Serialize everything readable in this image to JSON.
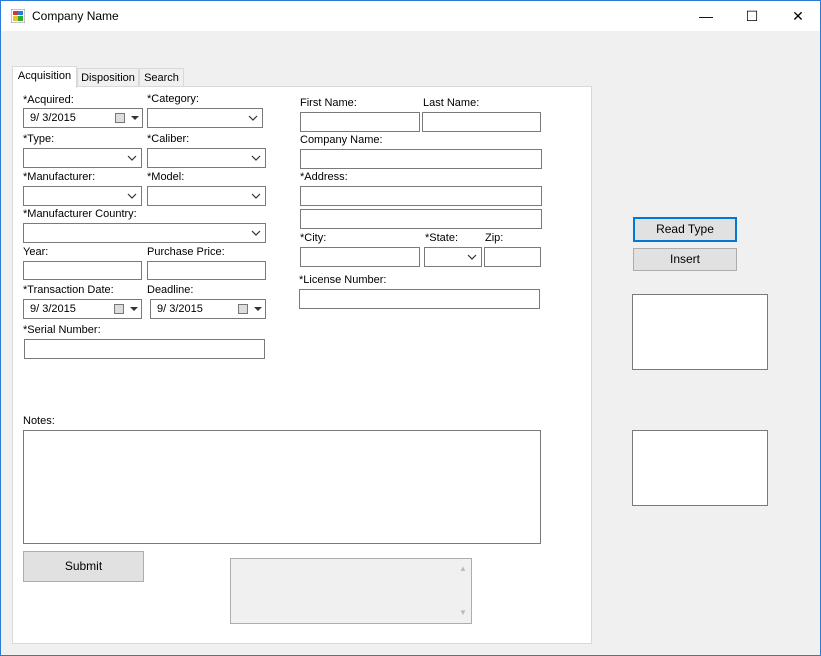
{
  "window": {
    "title": "Company Name",
    "minimize": "—",
    "maximize": "☐",
    "close": "✕"
  },
  "tabs": [
    "Acquisition",
    "Disposition",
    "Search"
  ],
  "form": {
    "acquired": {
      "label": "*Acquired:",
      "value": "9/  3/2015"
    },
    "category": {
      "label": "*Category:",
      "value": ""
    },
    "type": {
      "label": "*Type:",
      "value": ""
    },
    "caliber": {
      "label": "*Caliber:",
      "value": ""
    },
    "manufacturer": {
      "label": "*Manufacturer:",
      "value": ""
    },
    "model": {
      "label": "*Model:",
      "value": ""
    },
    "manufacturer_country": {
      "label": "*Manufacturer Country:",
      "value": ""
    },
    "year": {
      "label": "Year:",
      "value": ""
    },
    "purchase_price": {
      "label": "Purchase Price:",
      "value": ""
    },
    "transaction_date": {
      "label": "*Transaction Date:",
      "value": "9/  3/2015"
    },
    "deadline": {
      "label": "Deadline:",
      "value": "9/  3/2015"
    },
    "serial_number": {
      "label": "*Serial Number:",
      "value": ""
    },
    "first_name": {
      "label": "First Name:",
      "value": ""
    },
    "last_name": {
      "label": "Last Name:",
      "value": ""
    },
    "company_name": {
      "label": "Company Name:",
      "value": ""
    },
    "address": {
      "label": "*Address:",
      "value": "",
      "value2": ""
    },
    "city": {
      "label": "*City:",
      "value": ""
    },
    "state": {
      "label": "*State:",
      "value": ""
    },
    "zip": {
      "label": "Zip:",
      "value": ""
    },
    "license_number": {
      "label": "*License Number:",
      "value": ""
    },
    "notes": {
      "label": "Notes:",
      "value": ""
    },
    "submit": "Submit"
  },
  "side": {
    "read_type": "Read Type",
    "insert": "Insert"
  }
}
